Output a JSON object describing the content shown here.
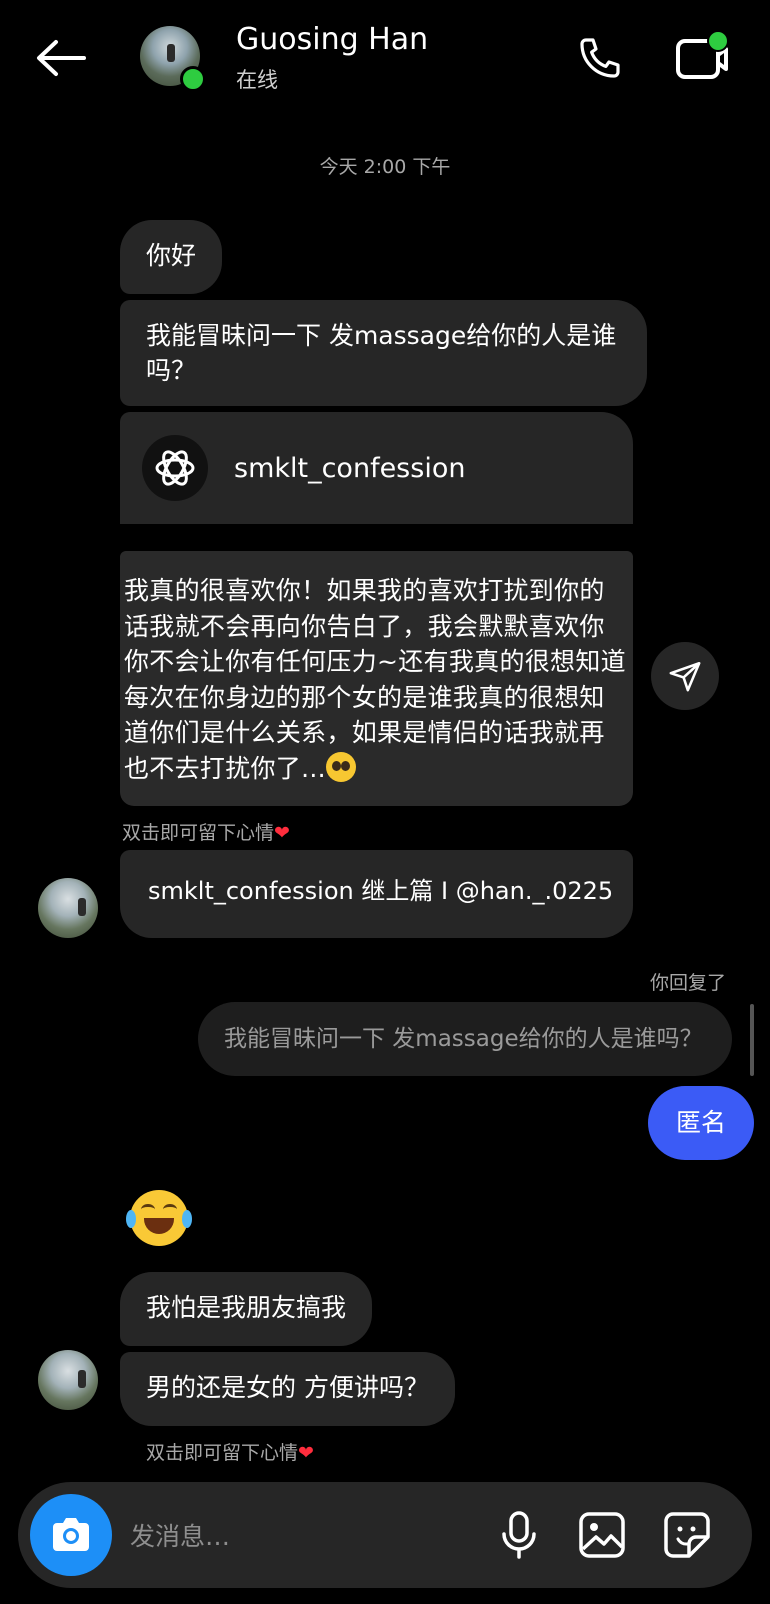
{
  "header": {
    "contact_name": "Guosing Han",
    "status": "在线"
  },
  "timestamp": "今天 2:00 下午",
  "messages": {
    "hello": "你好",
    "ask": "我能冒昧问一下 发massage给你的人是谁吗？",
    "shared_account": "smklt_confession",
    "confession_text": "我真的很喜欢你！如果我的喜欢打扰到你的话我就不会再向你告白了，我会默默喜欢你你不会让你有任何压力~还有我真的很想知道每次在你身边的那个女的是谁我真的很想知道你们是什么关系，如果是情侣的话我就再也不去打扰你了...",
    "double_tap_hint": "双击即可留下心情",
    "reply_share": "smklt_confession 继上篇 I @han._.0225",
    "you_replied_label": "你回复了",
    "quoted_reply": "我能冒昧问一下 发massage给你的人是谁吗？",
    "anonymous": "匿名",
    "emoji_reaction": "face-with-tears-of-joy",
    "prank": "我怕是我朋友搞我",
    "gender_question": "男的还是女的 方便讲吗？",
    "double_tap_hint_2": "双击即可留下心情"
  },
  "composer": {
    "placeholder": "发消息…"
  },
  "colors": {
    "background": "#000000",
    "bubble": "#262626",
    "sent_bubble": "#3b5bf6",
    "online": "#2ecc40",
    "camera": "#1d8ff7",
    "heart": "#ff2d3d"
  }
}
